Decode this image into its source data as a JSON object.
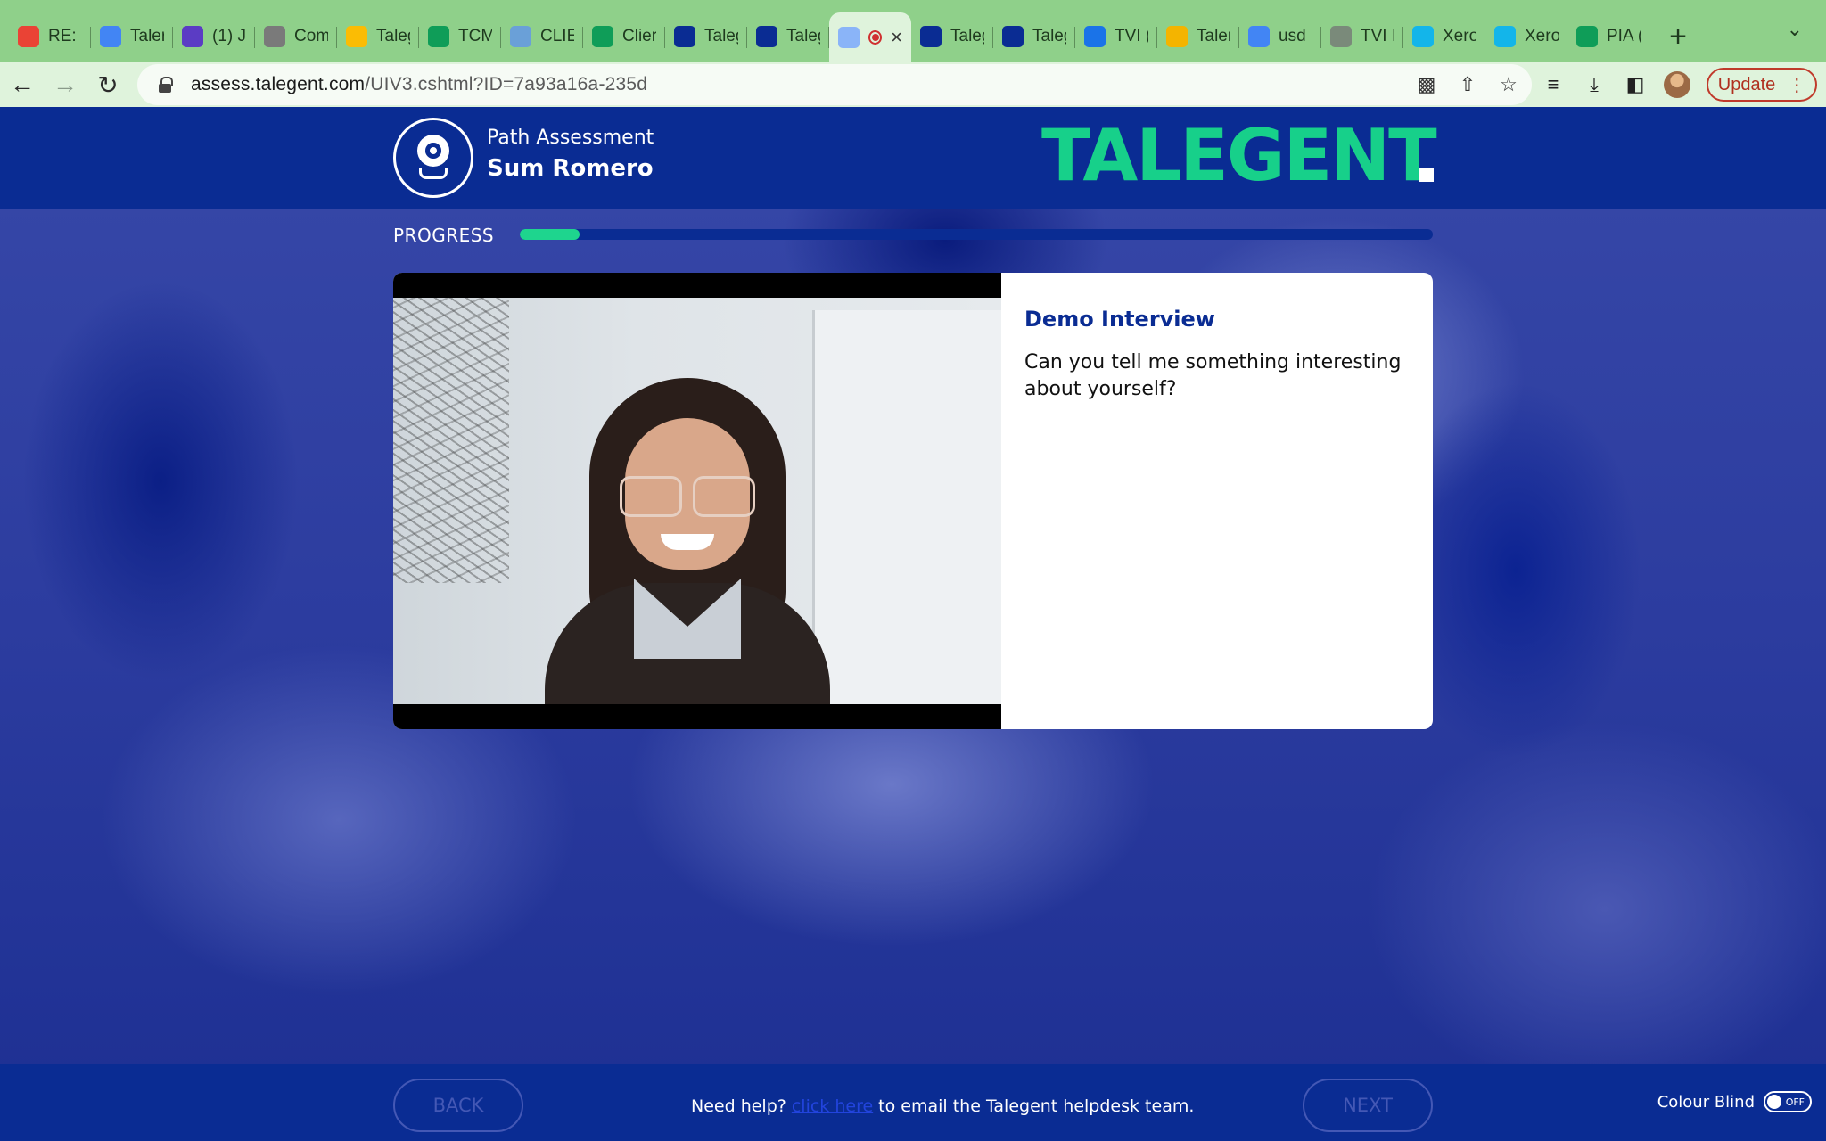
{
  "browser": {
    "tabs": [
      {
        "label": "RE: (",
        "icon": "gmail-icon",
        "color": "#ea4335"
      },
      {
        "label": "Taler",
        "icon": "calendar-icon",
        "color": "#4285f4"
      },
      {
        "label": "(1) J",
        "icon": "webex-icon",
        "color": "#5b3cc4"
      },
      {
        "label": "Com",
        "icon": "globe-icon",
        "color": "#7a7a7a"
      },
      {
        "label": "Taleg",
        "icon": "drive-icon",
        "color": "#fbbc04"
      },
      {
        "label": "TCM",
        "icon": "sheets-icon",
        "color": "#0f9d58"
      },
      {
        "label": "CLIE",
        "icon": "ring-icon",
        "color": "#6aa0d8"
      },
      {
        "label": "Clier",
        "icon": "sheets-icon",
        "color": "#0f9d58"
      },
      {
        "label": "Taleg",
        "icon": "square-app-icon",
        "color": "#0a2c93"
      },
      {
        "label": "Taleg",
        "icon": "square-app-icon",
        "color": "#0a2c93"
      },
      {
        "label": "",
        "icon": "doc-icon",
        "color": "#8ab4f8",
        "active": true
      },
      {
        "label": "Taleg",
        "icon": "square-app-icon",
        "color": "#0a2c93"
      },
      {
        "label": "Taleg",
        "icon": "square-app-icon",
        "color": "#0a2c93"
      },
      {
        "label": "TVI (",
        "icon": "tv-icon",
        "color": "#1a73e8"
      },
      {
        "label": "Taler",
        "icon": "slides-icon",
        "color": "#f4b400"
      },
      {
        "label": "usd",
        "icon": "google-icon",
        "color": "#4285f4"
      },
      {
        "label": "TVI I",
        "icon": "tvi-icon",
        "color": "#7a8a7a"
      },
      {
        "label": "Xero",
        "icon": "xero-icon",
        "color": "#13b5ea"
      },
      {
        "label": "Xero",
        "icon": "xero-icon",
        "color": "#13b5ea"
      },
      {
        "label": "PIA (",
        "icon": "sheets-icon",
        "color": "#0f9d58"
      }
    ],
    "url_host": "assess.talegent.com",
    "url_path": "/UIV3.cshtml?ID=7a93a16a-235d",
    "update_label": "Update"
  },
  "header": {
    "subtitle": "Path Assessment",
    "name": "Sum Romero",
    "brand": "TALEGENT"
  },
  "progress": {
    "label": "PROGRESS",
    "fraction": 0.065
  },
  "question": {
    "title": "Demo Interview",
    "text": "Can you tell me something interesting about yourself?"
  },
  "footer": {
    "back_label": "BACK",
    "next_label": "NEXT",
    "help_prefix": "Need help?",
    "help_link": "click here",
    "help_suffix": "to email the Talegent helpdesk team.",
    "colour_blind_label": "Colour Blind",
    "toggle_state": "OFF"
  },
  "colors": {
    "brand_green": "#17d08a",
    "brand_blue": "#0a2c93"
  }
}
